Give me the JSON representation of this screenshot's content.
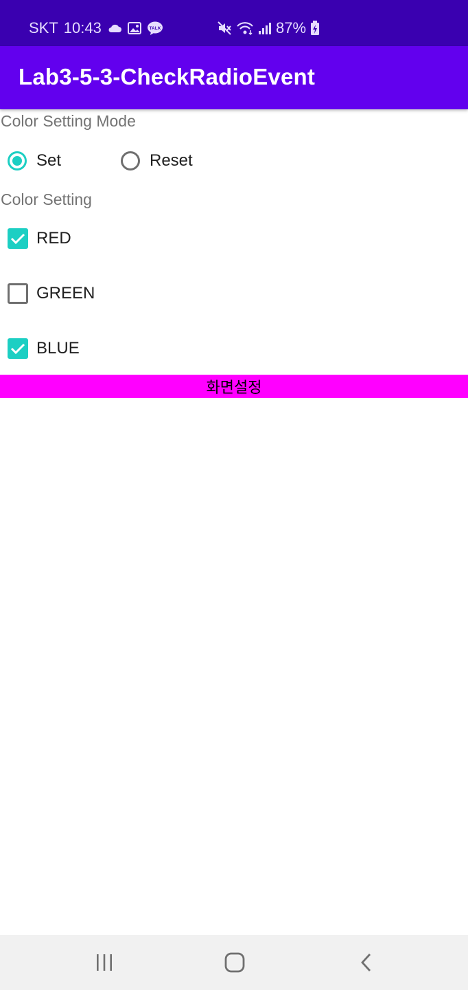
{
  "status_bar": {
    "carrier": "SKT",
    "time": "10:43",
    "battery_percent": "87%",
    "left_icons": [
      "cloud-icon",
      "gallery-icon",
      "kakaotalk-icon"
    ],
    "right_icons": [
      "mute-icon",
      "wifi-icon",
      "signal-icon",
      "battery-charging-icon"
    ]
  },
  "app_bar": {
    "title": "Lab3-5-3-CheckRadioEvent"
  },
  "mode_section": {
    "label": "Color Setting Mode",
    "options": [
      {
        "label": "Set",
        "checked": true
      },
      {
        "label": "Reset",
        "checked": false
      }
    ]
  },
  "color_section": {
    "label": "Color Setting",
    "items": [
      {
        "label": "RED",
        "checked": true
      },
      {
        "label": "GREEN",
        "checked": false
      },
      {
        "label": "BLUE",
        "checked": true
      }
    ]
  },
  "apply_button": {
    "label": "화면설정",
    "color": "#ff00ff"
  },
  "colors": {
    "status_bar": "#3a00b0",
    "app_bar": "#6200ee",
    "accent": "#1ccfc3"
  },
  "nav_bar": {
    "icons": [
      "recent-apps-icon",
      "home-icon",
      "back-icon"
    ]
  }
}
